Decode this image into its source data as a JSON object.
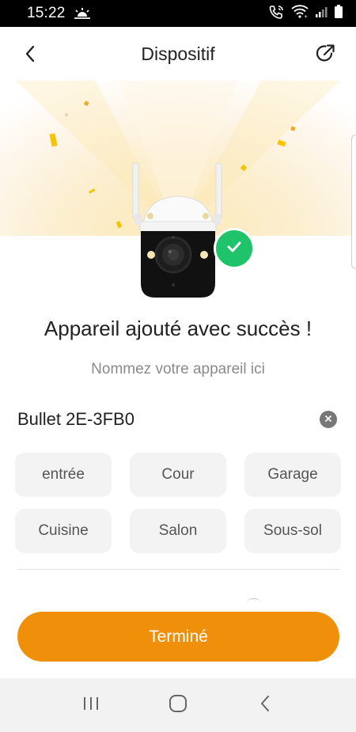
{
  "status_bar": {
    "time": "15:22",
    "icons": [
      "weather-sunrise-icon",
      "wifi-calling-icon",
      "wifi-icon",
      "signal-icon",
      "battery-icon"
    ]
  },
  "header": {
    "title": "Dispositif",
    "back_icon": "chevron-left-icon",
    "share_icon": "external-link-icon"
  },
  "hero": {
    "device_image": "outdoor-bullet-camera",
    "badge_icon": "checkmark-icon"
  },
  "success": {
    "title": "Appareil ajouté avec succès !",
    "hint": "Nommez votre appareil ici"
  },
  "name_field": {
    "value": "Bullet 2E-3FB0",
    "clear_icon": "clear-x-icon"
  },
  "suggestions": [
    {
      "label": "entrée"
    },
    {
      "label": "Cour"
    },
    {
      "label": "Garage"
    },
    {
      "label": "Cuisine"
    },
    {
      "label": "Salon"
    },
    {
      "label": "Sous-sol"
    }
  ],
  "done_button": {
    "label": "Terminé"
  },
  "nav_bar": {
    "recents_icon": "recents-icon",
    "home_icon": "home-icon",
    "back_icon": "back-chevron-icon"
  },
  "colors": {
    "accent": "#f0900a",
    "success": "#1fc36a",
    "chip_bg": "#f3f3f3",
    "hint_text": "#8a8a8a"
  }
}
